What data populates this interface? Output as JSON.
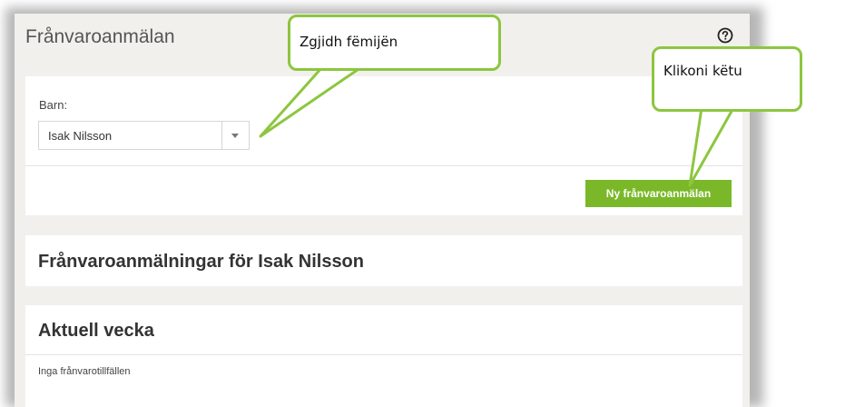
{
  "panel": {
    "title": "Frånvaroanmälan",
    "help_icon": "question-circle-icon"
  },
  "form": {
    "child_label": "Barn:",
    "child_select_value": "Isak Nilsson",
    "new_button_label": "Ny frånvaroanmälan"
  },
  "section": {
    "heading": "Frånvaroanmälningar för Isak Nilsson"
  },
  "week": {
    "heading": "Aktuell vecka",
    "empty_text": "Inga frånvarotillfällen"
  },
  "callouts": {
    "select_child": "Zgjidh fëmijën",
    "click_here": "Klikoni këtu"
  },
  "colors": {
    "accent_green": "#7ab829",
    "callout_border": "#8cc63f",
    "panel_bg": "#f1f0ed"
  }
}
